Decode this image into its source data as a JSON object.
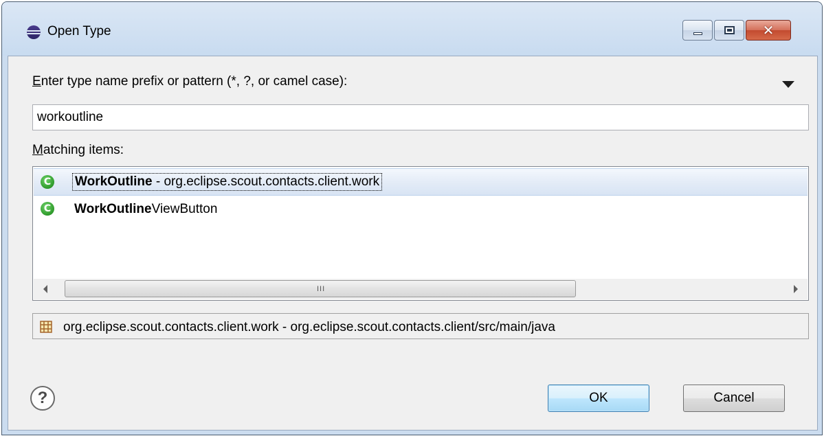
{
  "window": {
    "title": "Open Type"
  },
  "titlebar_buttons": {
    "minimize_icon": "minimize-icon",
    "maximize_icon": "maximize-icon",
    "close_glyph": "✕"
  },
  "search": {
    "label_mnemonic": "E",
    "label_rest": "nter type name prefix or pattern (*, ?, or camel case):",
    "value": "workoutline"
  },
  "matching": {
    "label_mnemonic": "M",
    "label_rest": "atching items:",
    "items": [
      {
        "bold": "WorkOutline",
        "rest": " - org.eclipse.scout.contacts.client.work",
        "selected": true,
        "icon": "class-icon"
      },
      {
        "bold": "WorkOutline",
        "rest": "ViewButton",
        "selected": false,
        "icon": "class-icon"
      }
    ]
  },
  "scrollbar": {
    "grip": "III"
  },
  "status": {
    "icon": "package-icon",
    "text": "org.eclipse.scout.contacts.client.work - org.eclipse.scout.contacts.client/src/main/java"
  },
  "buttons": {
    "help": "?",
    "ok": "OK",
    "cancel": "Cancel"
  },
  "colors": {
    "titlebar": "#c8dbf0",
    "class_icon": "#2e9a2a",
    "selection": "#d8e4f4",
    "close_button": "#c24a2f"
  }
}
